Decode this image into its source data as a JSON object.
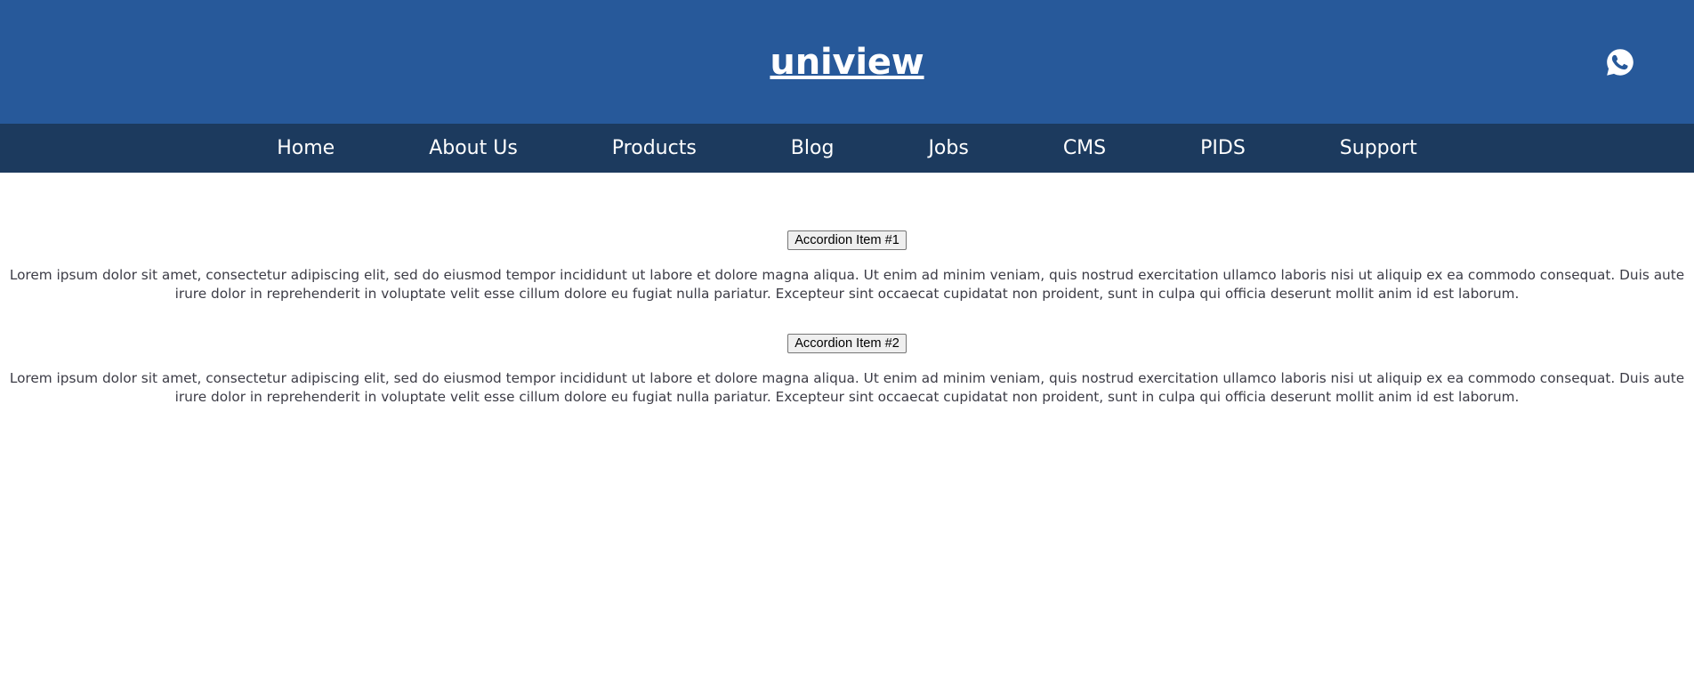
{
  "header": {
    "brand": "uniview",
    "background_color": "#27599a",
    "text_color": "#ffffff",
    "contact_icon": "whatsapp-icon"
  },
  "nav": {
    "background_color": "#1c3a5e",
    "text_color": "#ffffff",
    "items": [
      {
        "label": "Home"
      },
      {
        "label": "About Us"
      },
      {
        "label": "Products"
      },
      {
        "label": "Blog"
      },
      {
        "label": "Jobs"
      },
      {
        "label": "CMS"
      },
      {
        "label": "PIDS"
      },
      {
        "label": "Support"
      }
    ]
  },
  "main": {
    "accordion": [
      {
        "button_label": "Accordion Item #1",
        "body": "Lorem ipsum dolor sit amet, consectetur adipiscing elit, sed do eiusmod tempor incididunt ut labore et dolore magna aliqua. Ut enim ad minim veniam, quis nostrud exercitation ullamco laboris nisi ut aliquip ex ea commodo consequat. Duis aute irure dolor in reprehenderit in voluptate velit esse cillum dolore eu fugiat nulla pariatur. Excepteur sint occaecat cupidatat non proident, sunt in culpa qui officia deserunt mollit anim id est laborum."
      },
      {
        "button_label": "Accordion Item #2",
        "body": "Lorem ipsum dolor sit amet, consectetur adipiscing elit, sed do eiusmod tempor incididunt ut labore et dolore magna aliqua. Ut enim ad minim veniam, quis nostrud exercitation ullamco laboris nisi ut aliquip ex ea commodo consequat. Duis aute irure dolor in reprehenderit in voluptate velit esse cillum dolore eu fugiat nulla pariatur. Excepteur sint occaecat cupidatat non proident, sunt in culpa qui officia deserunt mollit anim id est laborum."
      }
    ]
  }
}
